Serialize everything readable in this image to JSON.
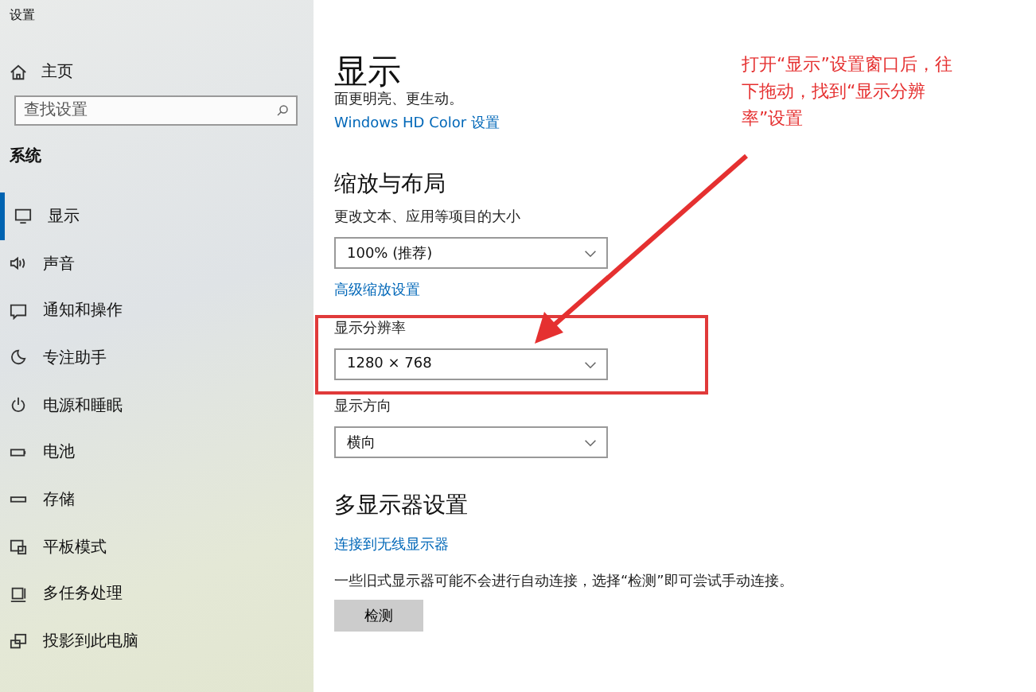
{
  "window": {
    "title": "设置"
  },
  "sidebar": {
    "home": "主页",
    "search": {
      "placeholder": "查找设置"
    },
    "section": "系统",
    "items": [
      {
        "label": "显示",
        "selected": true
      },
      {
        "label": "声音",
        "selected": false
      },
      {
        "label": "通知和操作",
        "selected": false
      },
      {
        "label": "专注助手",
        "selected": false
      },
      {
        "label": "电源和睡眠",
        "selected": false
      },
      {
        "label": "电池",
        "selected": false
      },
      {
        "label": "存储",
        "selected": false
      },
      {
        "label": "平板模式",
        "selected": false
      },
      {
        "label": "多任务处理",
        "selected": false
      },
      {
        "label": "投影到此电脑",
        "selected": false
      }
    ]
  },
  "main": {
    "title": "显示",
    "subtitle": "面更明亮、更生动。",
    "hd_link": "Windows HD Color 设置",
    "layout": {
      "heading": "缩放与布局",
      "scale_label": "更改文本、应用等项目的大小",
      "scale_value": "100% (推荐)",
      "advanced_link": "高级缩放设置",
      "resolution_label": "显示分辨率",
      "resolution_value": "1280 × 768",
      "orientation_label": "显示方向",
      "orientation_value": "横向"
    },
    "multi": {
      "heading": "多显示器设置",
      "wireless_link": "连接到无线显示器",
      "note": "一些旧式显示器可能不会进行自动连接，选择“检测”即可尝试手动连接。",
      "detect_button": "检测"
    }
  },
  "annotation": {
    "text": "打开“显示”设置窗口后，往下拖动，找到“显示分辨率”设置"
  }
}
